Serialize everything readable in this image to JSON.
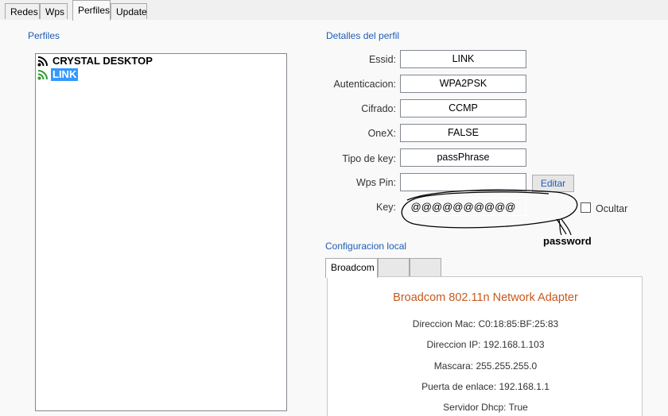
{
  "tabs": [
    {
      "label": "Redes"
    },
    {
      "label": "Wps"
    },
    {
      "label": "Perfiles"
    },
    {
      "label": "Update"
    }
  ],
  "profiles": {
    "title": "Perfiles",
    "items": [
      {
        "label": "CRYSTAL DESKTOP",
        "selected": false
      },
      {
        "label": "LINK",
        "selected": true
      }
    ]
  },
  "details": {
    "title": "Detalles del perfil",
    "essid_label": "Essid:",
    "essid_value": "LINK",
    "auth_label": "Autenticacion:",
    "auth_value": "WPA2PSK",
    "cipher_label": "Cifrado:",
    "cipher_value": "CCMP",
    "onex_label": "OneX:",
    "onex_value": "FALSE",
    "keytype_label": "Tipo de key:",
    "keytype_value": "passPhrase",
    "wpspin_label": "Wps Pin:",
    "wpspin_value": "",
    "edit_button": "Editar",
    "key_label": "Key:",
    "key_value": "@@@@@@@@@@",
    "hide_label": "Ocultar",
    "hide_checked": false,
    "annotation": "password"
  },
  "local": {
    "title": "Configuracion local",
    "tabs": [
      {
        "label": "Broadcom"
      },
      {
        "label": ""
      },
      {
        "label": ""
      }
    ],
    "adapter_name": "Broadcom 802.11n Network Adapter",
    "mac": "Direccion Mac: C0:18:85:BF:25:83",
    "ip": "Direccion IP: 192.168.1.103",
    "mask": "Mascara: 255.255.255.0",
    "gateway": "Puerta de enlace: 192.168.1.1",
    "dhcp": "Servidor Dhcp: True"
  },
  "colors": {
    "accent": "#1e5cb3",
    "adapter_title": "#c65a1e",
    "selection": "#3399ff"
  }
}
